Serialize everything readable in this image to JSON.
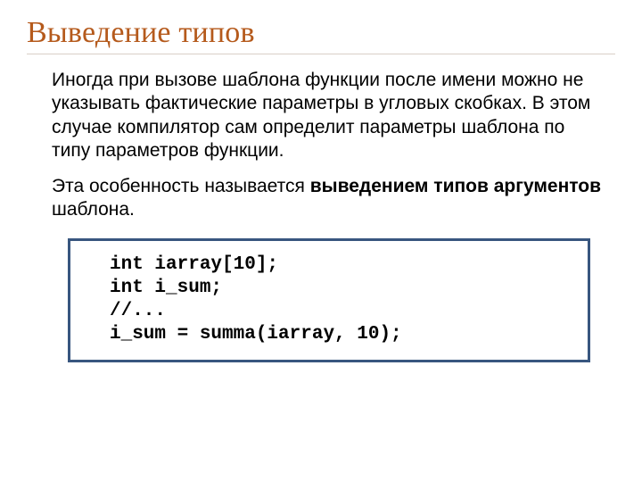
{
  "title": "Выведение типов",
  "para1": "Иногда при вызове шаблона функции после имени можно не указывать фактические параметры в угловых скобках. В этом случае компилятор сам определит параметры шаблона по типу параметров функции.",
  "para2_a": "Эта особенность называется ",
  "para2_bold": "выведением типов аргументов",
  "para2_c": " шаблона.",
  "code": "int iarray[10];\nint i_sum;\n//...\ni_sum = summa(iarray, 10);"
}
